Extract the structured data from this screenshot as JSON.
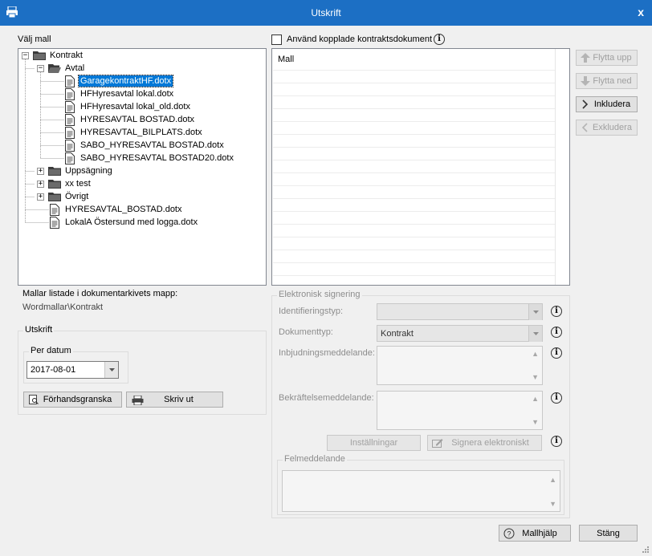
{
  "window": {
    "title": "Utskrift",
    "close_label": "x"
  },
  "left": {
    "section_label": "Välj mall",
    "tree": {
      "root": "Kontrakt",
      "folder_avtal": "Avtal",
      "avtal_files": [
        "GaragekontraktHF.dotx",
        "HFHyresavtal lokal.dotx",
        "HFHyresavtal lokal_old.dotx",
        "HYRESAVTAL BOSTAD.dotx",
        "HYRESAVTAL_BILPLATS.dotx",
        "SABO_HYRESAVTAL BOSTAD.dotx",
        "SABO_HYRESAVTAL BOSTAD20.dotx"
      ],
      "folders": [
        "Uppsägning",
        "xx test",
        "Övrigt"
      ],
      "root_files": [
        "HYRESAVTAL_BOSTAD.dotx",
        "LokalA Östersund med logga.dotx"
      ]
    },
    "folder_info_label": "Mallar listade i dokumentarkivets mapp:",
    "folder_path": "Wordmallar\\Kontrakt"
  },
  "print": {
    "group_label": "Utskrift",
    "per_datum_label": "Per datum",
    "date_value": "2017-08-01",
    "preview_button": "Förhandsgranska",
    "print_button": "Skriv ut"
  },
  "right": {
    "checkbox_label": "Använd kopplade kontraktsdokument",
    "list_header": "Mall",
    "buttons": {
      "move_up": "Flytta upp",
      "move_down": "Flytta ned",
      "include": "Inkludera",
      "exclude": "Exkludera"
    }
  },
  "esign": {
    "group_label": "Elektronisk signering",
    "identification_label": "Identifieringstyp:",
    "identification_value": "",
    "doctype_label": "Dokumenttyp:",
    "doctype_value": "Kontrakt",
    "invite_label": "Inbjudningsmeddelande:",
    "confirm_label": "Bekräftelsemeddelande:",
    "settings_button": "Inställningar",
    "sign_button": "Signera elektroniskt",
    "error_group_label": "Felmeddelande"
  },
  "footer": {
    "help_button": "Mallhjälp",
    "close_button": "Stäng"
  },
  "colors": {
    "titlebar": "#1c6fc4",
    "selection": "#0078d7",
    "folder": "#3a3a3a"
  }
}
